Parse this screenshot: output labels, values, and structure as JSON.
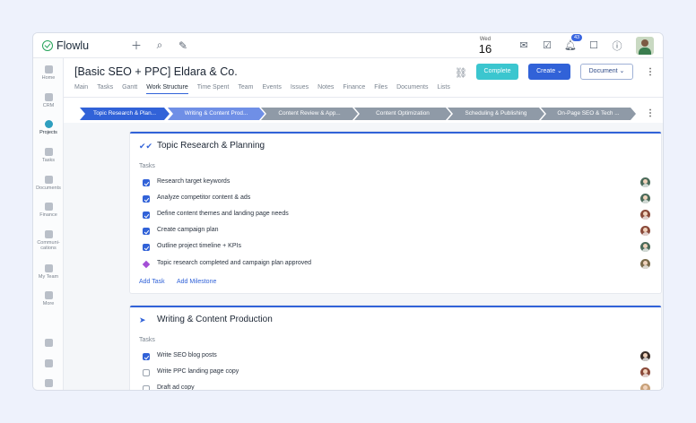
{
  "app": {
    "name": "Flowlu",
    "date": {
      "weekday": "Wed",
      "day": "16"
    },
    "notifications_count": "43"
  },
  "icons": {
    "add": "plus-icon",
    "search": "search-icon",
    "quick": "note-icon",
    "mail": "mail-icon",
    "tasks": "tasks-icon",
    "bell": "bell-icon",
    "chat": "chat-icon",
    "help": "help-icon",
    "link": "link-icon"
  },
  "sidebar": {
    "items": [
      {
        "label": "Home",
        "icon": "home-icon"
      },
      {
        "label": "CRM",
        "icon": "crm-icon"
      },
      {
        "label": "Projects",
        "icon": "projects-icon",
        "active": true
      },
      {
        "label": "Tasks",
        "icon": "tasks-icon"
      },
      {
        "label": "Documents",
        "icon": "documents-icon"
      },
      {
        "label": "Finance",
        "icon": "finance-icon"
      },
      {
        "label": "Communi-\ncations",
        "icon": "communications-icon"
      },
      {
        "label": "My Team",
        "icon": "team-icon"
      },
      {
        "label": "More",
        "icon": "more-icon"
      }
    ]
  },
  "project": {
    "title": "[Basic SEO + PPC] Eldara & Co.",
    "complete_label": "Complete",
    "create_label": "Create",
    "document_label": "Document",
    "tabs": [
      "Main",
      "Tasks",
      "Gantt",
      "Work Structure",
      "Time Spent",
      "Team",
      "Events",
      "Issues",
      "Notes",
      "Finance",
      "Files",
      "Documents",
      "Lists"
    ],
    "active_tab": "Work Structure"
  },
  "stages": [
    {
      "label": "Topic Research & Plan...",
      "color": "#3162d8"
    },
    {
      "label": "Writing & Content Prod...",
      "color": "#6f8fe6"
    },
    {
      "label": "Content Review & App...",
      "color": "#8f9aa7"
    },
    {
      "label": "Content Optimization",
      "color": "#8f9aa7"
    },
    {
      "label": "Scheduling & Publishing",
      "color": "#8f9aa7"
    },
    {
      "label": "On-Page SEO & Tech ...",
      "color": "#8f9aa7"
    }
  ],
  "cards": [
    {
      "title": "Topic Research & Planning",
      "tasks_label": "Tasks",
      "rows": [
        {
          "text": "Research target keywords",
          "done": true,
          "avatar_color": "#4b6b5a"
        },
        {
          "text": "Analyze competitor content & ads",
          "done": true,
          "avatar_color": "#4b6b5a"
        },
        {
          "text": "Define content themes and landing page needs",
          "done": true,
          "avatar_color": "#8a4a3a"
        },
        {
          "text": "Create campaign plan",
          "done": true,
          "avatar_color": "#8a4a3a"
        },
        {
          "text": "Outline project timeline + KPIs",
          "done": true,
          "avatar_color": "#4b6b5a"
        },
        {
          "text": "Topic research completed and campaign plan approved",
          "milestone": true,
          "avatar_color": "#7a6a4a"
        }
      ],
      "add_task": "Add Task",
      "add_milestone": "Add Milestone"
    },
    {
      "title": "Writing & Content Production",
      "tasks_label": "Tasks",
      "rows": [
        {
          "text": "Write SEO blog posts",
          "done": true,
          "avatar_color": "#3a2e28"
        },
        {
          "text": "Write PPC landing page copy",
          "done": false,
          "avatar_color": "#8a4a3a"
        },
        {
          "text": "Draft ad copy",
          "done": false,
          "avatar_color": "#c8a27a"
        }
      ]
    }
  ]
}
